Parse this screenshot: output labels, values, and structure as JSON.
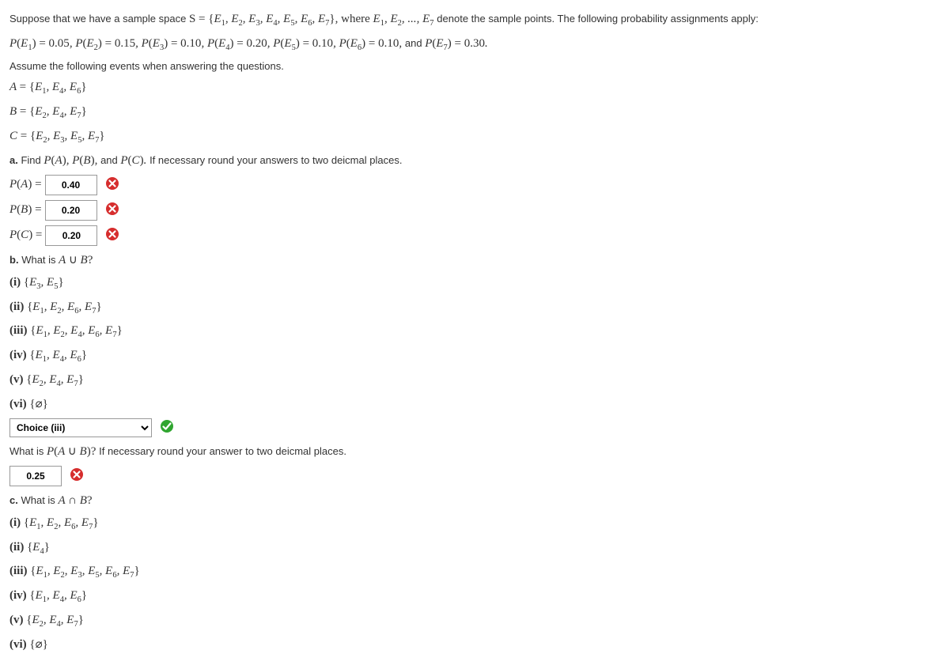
{
  "intro": {
    "text1_pre": "Suppose that we have a sample space ",
    "text1_post": " denote the sample points. The following probability assignments apply:",
    "S_def": "S = {E₁, E₂, E₃, E₄, E₅, E₆, E₇}, where E₁, E₂, ..., E₇",
    "probs": "P(E₁) = 0.05, P(E₂) = 0.15, P(E₃) = 0.10, P(E₄) = 0.20, P(E₅) = 0.10, P(E₆) = 0.10, ",
    "probs_and": "and ",
    "probs_last": "P(E₇) = 0.30.",
    "assume": "Assume the following events when answering the questions.",
    "A_def": "A = {E₁, E₄, E₆}",
    "B_def": "B = {E₂, E₄, E₇}",
    "C_def": "C = {E₂, E₃, E₅, E₇}"
  },
  "a": {
    "label": "a.",
    "prompt_pre": " Find ",
    "prompt_mid": "P(A), P(B), ",
    "prompt_and": "and ",
    "prompt_pc": "P(C). ",
    "prompt_post": "If necessary round your answers to two deicmal places.",
    "PA_label": "P(A) =",
    "PA_val": "0.40",
    "PB_label": "P(B) =",
    "PB_val": "0.20",
    "PC_label": "P(C) =",
    "PC_val": "0.20"
  },
  "b": {
    "label": "b.",
    "prompt_pre": " What is ",
    "prompt_math": "A ∪ B?",
    "opts": {
      "i": "(i) {E₃, E₅}",
      "ii": "(ii) {E₁, E₂, E₆, E₇}",
      "iii": "(iii) {E₁, E₂, E₄, E₆, E₇}",
      "iv": "(iv) {E₁, E₄, E₆}",
      "v": "(v) {E₂, E₄, E₇}",
      "vi": "(vi) {⌀}"
    },
    "select_val": "Choice (iii)",
    "p_prompt_pre": "What is ",
    "p_prompt_math": "P(A ∪ B)? ",
    "p_prompt_post": "If necessary round your answer to two deicmal places.",
    "p_val": "0.25"
  },
  "c": {
    "label": "c.",
    "prompt_pre": " What is ",
    "prompt_math": "A ∩ B?",
    "opts": {
      "i": "(i) {E₁, E₂, E₆, E₇}",
      "ii": "(ii) {E₄}",
      "iii": "(iii) {E₁, E₂, E₃, E₅, E₆, E₇}",
      "iv": "(iv) {E₁, E₄, E₆}",
      "v": "(v) {E₂, E₄, E₇}",
      "vi": "(vi) {⌀}"
    }
  }
}
